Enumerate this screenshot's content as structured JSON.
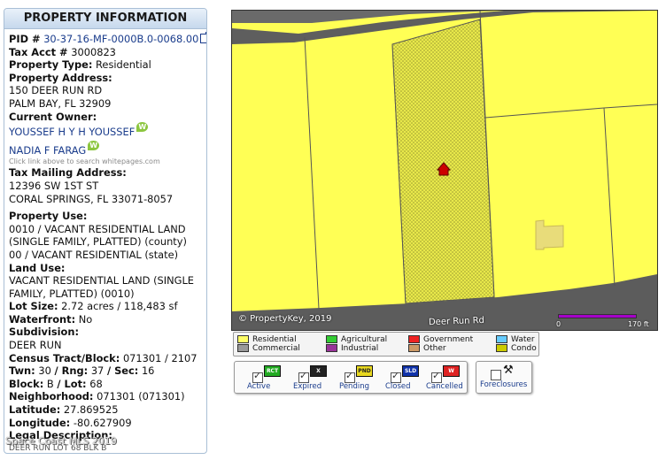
{
  "panel": {
    "title": "PROPERTY INFORMATION",
    "pid_label": "PID #",
    "pid_value": "30-37-16-MF-0000B.0-0068.00",
    "tax_label": "Tax Acct #",
    "tax_value": "3000823",
    "type_label": "Property Type:",
    "type_value": "Residential",
    "address_label": "Property Address:",
    "address_line1": "150 DEER RUN RD",
    "address_line2": "PALM BAY, FL 32909",
    "owner_label": "Current Owner:",
    "owners": [
      "YOUSSEF H Y H YOUSSEF",
      "NADIA F FARAG"
    ],
    "whitepages_hint": "Click link above to search whitepages.com",
    "mailing_label": "Tax Mailing Address:",
    "mailing_line1": "12396 SW 1ST ST",
    "mailing_line2": "CORAL SPRINGS, FL 33071-8057",
    "use_label": "Property Use:",
    "use_lines": [
      "0010 / VACANT RESIDENTIAL LAND",
      "(SINGLE FAMILY, PLATTED) (county)",
      "00 / VACANT RESIDENTIAL (state)"
    ],
    "landuse_label": "Land Use:",
    "landuse_lines": [
      "VACANT RESIDENTIAL LAND (SINGLE",
      "FAMILY, PLATTED) (0010)"
    ],
    "lotsize_label": "Lot Size:",
    "lotsize_value": "2.72 acres / 118,483 sf",
    "waterfront_label": "Waterfront:",
    "waterfront_value": "No",
    "subdivision_label": "Subdivision:",
    "subdivision_value": "DEER RUN",
    "census_label": "Census Tract/Block:",
    "census_value": "071301 / 2107",
    "twn_label": "Twn:",
    "twn_value": "30",
    "rng_label": "/ Rng:",
    "rng_value": "37",
    "sec_label": "/ Sec:",
    "sec_value": "16",
    "block_label": "Block:",
    "block_value": "B",
    "lot_label": "/ Lot:",
    "lot_value": "68",
    "neighborhood_label": "Neighborhood:",
    "neighborhood_value": "071301 (071301)",
    "latitude_label": "Latitude:",
    "latitude_value": "27.869525",
    "longitude_label": "Longitude:",
    "longitude_value": "-80.627909",
    "legal_label": "Legal Description:",
    "legal_value": "DEER RUN LOT 68 BLK B",
    "copyright": "Space Coast MLS 2019"
  },
  "map": {
    "copyright": "© PropertyKey, 2019",
    "road_label": "Deer Run Rd",
    "scale_start": "0",
    "scale_end": "170 ft"
  },
  "legend": {
    "items": [
      {
        "label": "Residential",
        "color": "#ffff66"
      },
      {
        "label": "Commercial",
        "color": "#999999"
      },
      {
        "label": "Agricultural",
        "color": "#33cc33"
      },
      {
        "label": "Industrial",
        "color": "#993399"
      },
      {
        "label": "Government",
        "color": "#ee2222"
      },
      {
        "label": "Other",
        "color": "#cc9966"
      },
      {
        "label": "Water",
        "color": "#66ccff"
      },
      {
        "label": "Condo",
        "color": "#cccc00"
      }
    ]
  },
  "filters": {
    "statuses": [
      {
        "label": "Active",
        "tag": "RCT",
        "color": "#22aa22"
      },
      {
        "label": "Expired",
        "tag": "X",
        "color": "#222222"
      },
      {
        "label": "Pending",
        "tag": "PND",
        "color": "#e8d820"
      },
      {
        "label": "Closed",
        "tag": "SLD",
        "color": "#1133aa"
      },
      {
        "label": "Cancelled",
        "tag": "W",
        "color": "#dd2222"
      }
    ],
    "foreclosures_label": "Foreclosures"
  }
}
